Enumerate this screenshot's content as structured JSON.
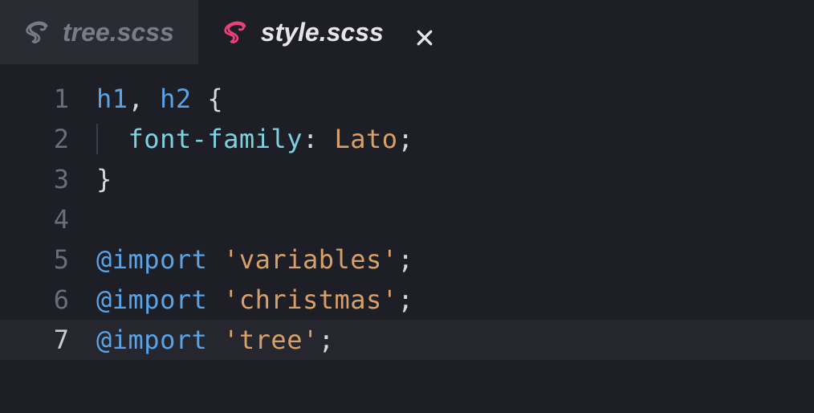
{
  "tabs": [
    {
      "label": "tree.scss",
      "active": false,
      "icon": "sass-icon"
    },
    {
      "label": "style.scss",
      "active": true,
      "icon": "sass-icon"
    }
  ],
  "colors": {
    "sass_pink": "#ec407a",
    "selector": "#5aa3e6",
    "property": "#7fd1e0",
    "value": "#d8a069",
    "plain": "#d6d8df"
  },
  "editor": {
    "current_line": 7,
    "lines": [
      {
        "num": "1",
        "tokens": [
          {
            "t": "h1",
            "c": "t-sel"
          },
          {
            "t": ", ",
            "c": "t-plain"
          },
          {
            "t": "h2",
            "c": "t-sel"
          },
          {
            "t": " {",
            "c": "t-plain"
          }
        ]
      },
      {
        "num": "2",
        "indent": true,
        "tokens": [
          {
            "t": "  ",
            "c": "t-plain"
          },
          {
            "t": "font-family",
            "c": "t-prop"
          },
          {
            "t": ": ",
            "c": "t-plain"
          },
          {
            "t": "Lato",
            "c": "t-val"
          },
          {
            "t": ";",
            "c": "t-plain"
          }
        ]
      },
      {
        "num": "3",
        "tokens": [
          {
            "t": "}",
            "c": "t-plain"
          }
        ]
      },
      {
        "num": "4",
        "tokens": []
      },
      {
        "num": "5",
        "tokens": [
          {
            "t": "@import",
            "c": "t-at"
          },
          {
            "t": " ",
            "c": "t-plain"
          },
          {
            "t": "'variables'",
            "c": "t-str"
          },
          {
            "t": ";",
            "c": "t-plain"
          }
        ]
      },
      {
        "num": "6",
        "tokens": [
          {
            "t": "@import",
            "c": "t-at"
          },
          {
            "t": " ",
            "c": "t-plain"
          },
          {
            "t": "'christmas'",
            "c": "t-str"
          },
          {
            "t": ";",
            "c": "t-plain"
          }
        ]
      },
      {
        "num": "7",
        "tokens": [
          {
            "t": "@import",
            "c": "t-at"
          },
          {
            "t": " ",
            "c": "t-plain"
          },
          {
            "t": "'tree'",
            "c": "t-str"
          },
          {
            "t": ";",
            "c": "t-plain"
          }
        ]
      }
    ]
  }
}
